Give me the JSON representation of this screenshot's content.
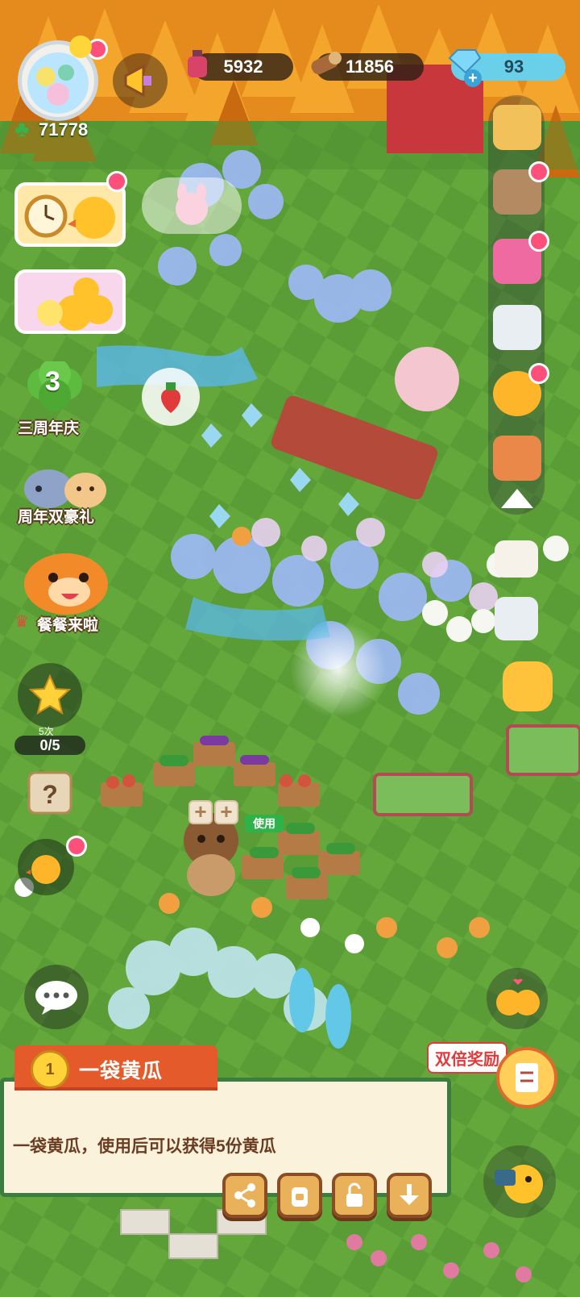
{
  "resources": {
    "potion": "5932",
    "wood": "11856",
    "gem": "93"
  },
  "player": {
    "clover_count": "71778"
  },
  "left_menu": {
    "anniversary_label": "三周年庆",
    "anniversary_number": "3",
    "double_gift_label": "周年双豪礼",
    "meal_label": "餐餐来啦",
    "star_task_sub": "5次",
    "star_task_progress": "0/5"
  },
  "item_popup": {
    "title": "一袋黄瓜",
    "rank": "1",
    "description": "一袋黄瓜，使用后可以获得5份黄瓜",
    "use_tag": "使用",
    "plus_symbol": "+"
  },
  "double_reward_label": "双倍奖励",
  "colors": {
    "grass": "#4e8f2f",
    "panel_bg": "#fbf2dc",
    "panel_border": "#3a7d3e",
    "title_tab": "#e45a2a",
    "action_btn": "#e9b25a",
    "notification": "#ff4f7b"
  },
  "icons": {
    "action_buttons": [
      "share-icon",
      "backpack-icon",
      "unlock-icon",
      "collect-icon"
    ],
    "right_rail": [
      "shop-icon",
      "pet-icon",
      "book-icon",
      "phone-icon",
      "chick-icon",
      "card-icon",
      "arrow-up-icon",
      "camera-icon",
      "mobile-icon",
      "bag-icon"
    ]
  }
}
